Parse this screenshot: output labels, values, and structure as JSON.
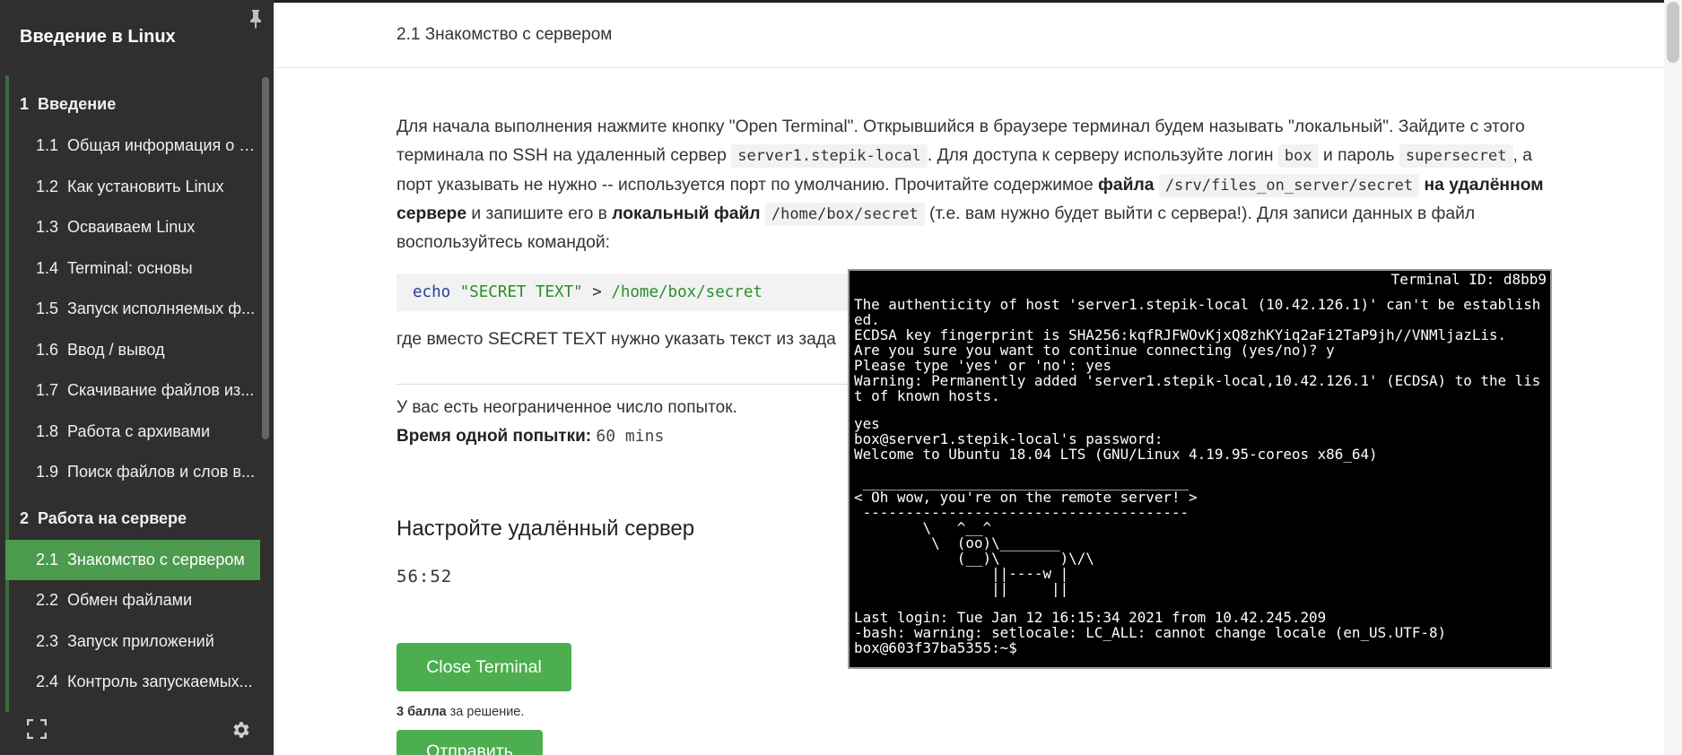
{
  "sidebar": {
    "course_title": "Введение в Linux",
    "pin_icon": "pin-icon",
    "items": [
      {
        "num": "1",
        "label": "Введение",
        "kind": "section"
      },
      {
        "num": "1.1",
        "label": "Общая информация о к...",
        "kind": "lesson"
      },
      {
        "num": "1.2",
        "label": "Как установить Linux",
        "kind": "lesson"
      },
      {
        "num": "1.3",
        "label": "Осваиваем Linux",
        "kind": "lesson"
      },
      {
        "num": "1.4",
        "label": "Terminal: основы",
        "kind": "lesson"
      },
      {
        "num": "1.5",
        "label": "Запуск исполняемых ф...",
        "kind": "lesson"
      },
      {
        "num": "1.6",
        "label": "Ввод / вывод",
        "kind": "lesson"
      },
      {
        "num": "1.7",
        "label": "Скачивание файлов из...",
        "kind": "lesson"
      },
      {
        "num": "1.8",
        "label": "Работа с архивами",
        "kind": "lesson"
      },
      {
        "num": "1.9",
        "label": "Поиск файлов и слов в...",
        "kind": "lesson"
      },
      {
        "num": "2",
        "label": "Работа на сервере",
        "kind": "section"
      },
      {
        "num": "2.1",
        "label": "Знакомство с сервером",
        "kind": "lesson",
        "active": true
      },
      {
        "num": "2.2",
        "label": "Обмен файлами",
        "kind": "lesson"
      },
      {
        "num": "2.3",
        "label": "Запуск приложений",
        "kind": "lesson"
      },
      {
        "num": "2.4",
        "label": "Контроль запускаемых...",
        "kind": "lesson"
      }
    ],
    "footer": {
      "expand_icon": "expand-icon",
      "settings_icon": "gear-icon"
    }
  },
  "header": {
    "lesson_title": "2.1 Знакомство с сервером"
  },
  "step": {
    "p1_a": "Для начала выполнения нажмите кнопку \"Open Terminal\". Открывшийся в браузере терминал будем называть \"локальный\". Зайдите с этого терминала по SSH на удаленный сервер ",
    "code_server": "server1.stepik-local",
    "p1_b": ". Для доступа к серверу используйте логин ",
    "code_login": "box",
    "p1_c": " и пароль ",
    "code_password": "supersecret",
    "p1_d": ", а порт указывать не нужно -- используется порт по умолчанию. Прочитайте содержимое ",
    "bold_file": "файла",
    "code_remote_path": "/srv/files_on_server/secret",
    "bold_remote": "на удалённом сервере",
    "p1_e": " и запишите его в ",
    "bold_local": "локальный файл",
    "code_local_path": "/home/box/secret",
    "p1_f": " (т.е. вам нужно будет выйти с сервера!). Для записи данных в файл воспользуйтесь командой:",
    "code_cmd": "echo",
    "code_str": "\"SECRET TEXT\"",
    "code_op": ">",
    "code_path": "/home/box/secret",
    "after_code": "где вместо SECRET TEXT нужно указать текст из зада",
    "attempts": "У вас есть неограниченное число попыток.",
    "attempt_time_label": "Время одной попытки:",
    "attempt_time_value": "60 mins",
    "task_title": "Настройте удалённый сервер",
    "timer": "56:52",
    "close_terminal_label": "Close Terminal",
    "score_bold": "3 балла",
    "score_rest": " за решение.",
    "submit_label": "Отправить"
  },
  "terminal": {
    "title": "Terminal ID: d8bb9",
    "lines": [
      "The authenticity of host 'server1.stepik-local (10.42.126.1)' can't be establish",
      "ed.",
      "ECDSA key fingerprint is SHA256:kqfRJFWOvKjxQ8zhKYiq2aFi2TaP9jh//VNMljazLis.",
      "Are you sure you want to continue connecting (yes/no)? y",
      "Please type 'yes' or 'no': yes",
      "Warning: Permanently added 'server1.stepik-local,10.42.126.1' (ECDSA) to the lis",
      "t of known hosts.",
      "",
      "yes",
      "box@server1.stepik-local's password:",
      "Welcome to Ubuntu 18.04 LTS (GNU/Linux 4.19.95-coreos x86_64)",
      "",
      " ______________________________________",
      "< Oh wow, you're on the remote server! >",
      " --------------------------------------",
      "        \\   ^__^",
      "         \\  (oo)\\_______",
      "            (__)\\       )\\/\\",
      "                ||----w |",
      "                ||     ||",
      "",
      "Last login: Tue Jan 12 16:15:34 2021 from 10.42.245.209",
      "-bash: warning: setlocale: LC_ALL: cannot change locale (en_US.UTF-8)",
      "box@603f37ba5355:~$"
    ]
  }
}
